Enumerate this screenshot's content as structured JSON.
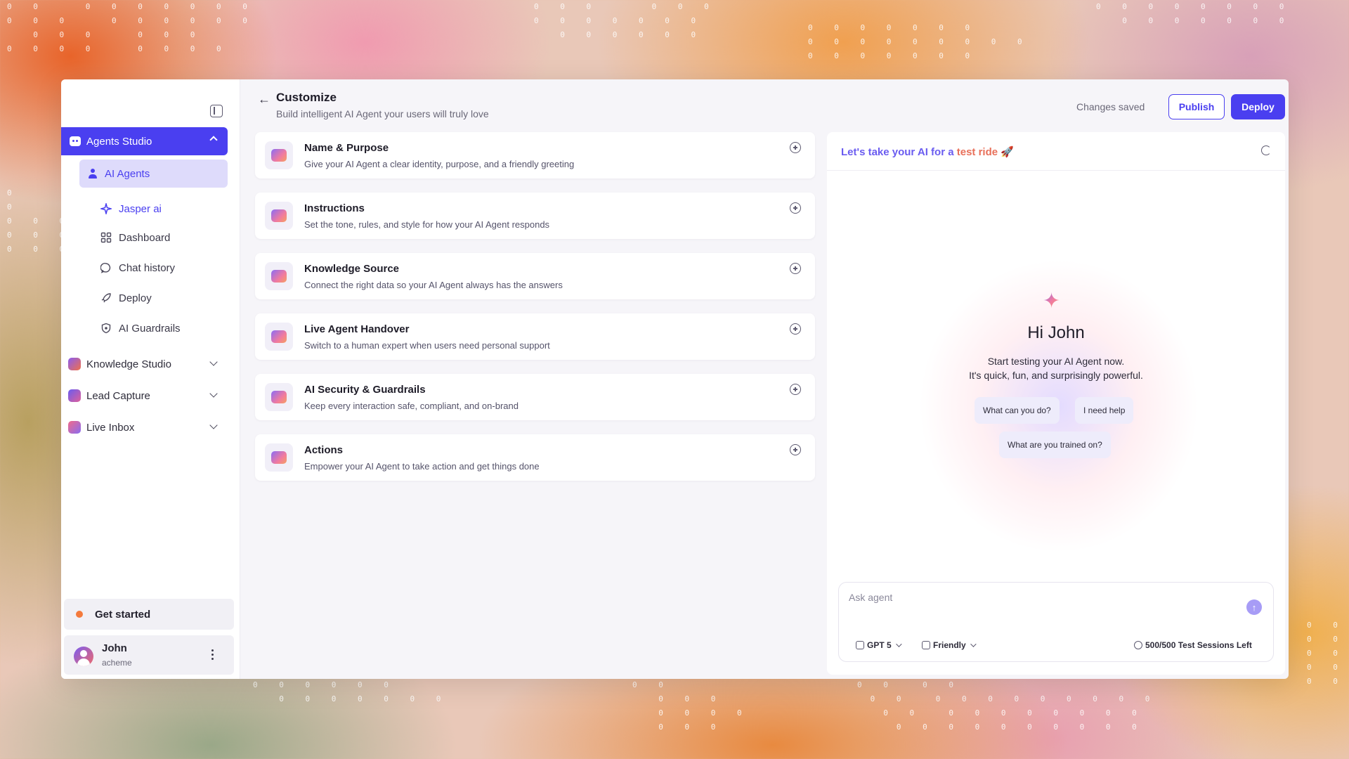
{
  "sidebar": {
    "primary": {
      "label": "Agents Studio"
    },
    "sub": {
      "label": "AI Agents"
    },
    "items": [
      {
        "label": "Jasper ai",
        "icon": "sparkle-agent-icon"
      },
      {
        "label": "Dashboard",
        "icon": "dashboard-icon"
      },
      {
        "label": "Chat history",
        "icon": "chat-icon"
      },
      {
        "label": "Deploy",
        "icon": "rocket-icon"
      },
      {
        "label": "AI Guardrails",
        "icon": "shield-icon"
      }
    ],
    "studios": [
      {
        "label": "Knowledge Studio",
        "color": "#f0704a"
      },
      {
        "label": "Lead Capture",
        "color": "#8a5cf0"
      },
      {
        "label": "Live Inbox",
        "color": "#e06aa0"
      }
    ],
    "get_started": "Get started",
    "user": {
      "name": "John",
      "org": "acheme"
    }
  },
  "header": {
    "title": "Customize",
    "subtitle": "Build intelligent AI Agent your users will truly love",
    "status": "Changes saved",
    "publish_label": "Publish",
    "deploy_label": "Deploy"
  },
  "sections": [
    {
      "title": "Name & Purpose",
      "desc": "Give your AI Agent a clear identity, purpose, and a friendly greeting"
    },
    {
      "title": "Instructions",
      "desc": "Set the tone, rules, and style for how your AI Agent responds"
    },
    {
      "title": "Knowledge Source",
      "desc": "Connect the right data so your AI Agent always has the answers"
    },
    {
      "title": "Live Agent Handover",
      "desc": "Switch to a human expert when users need personal support"
    },
    {
      "title": "AI Security & Guardrails",
      "desc": "Keep every interaction safe, compliant, and on-brand"
    },
    {
      "title": "Actions",
      "desc": "Empower your AI Agent to take action and get things done"
    }
  ],
  "test_panel": {
    "title_part1": "Let's take your AI for a ",
    "title_part2": "test ride",
    "title_emoji": "🚀",
    "greeting": "Hi John",
    "lead_line1": "Start testing your AI Agent now.",
    "lead_line2": "It's quick, fun, and surprisingly powerful.",
    "chips": [
      "What can you do?",
      "I need help",
      "What are you trained on?"
    ],
    "input_placeholder": "Ask agent",
    "model": "GPT 5",
    "tone": "Friendly",
    "sessions": "500/500 Test Sessions Left"
  },
  "colors": {
    "accent": "#4a3ff0",
    "accent_soft": "#dedbfb"
  }
}
